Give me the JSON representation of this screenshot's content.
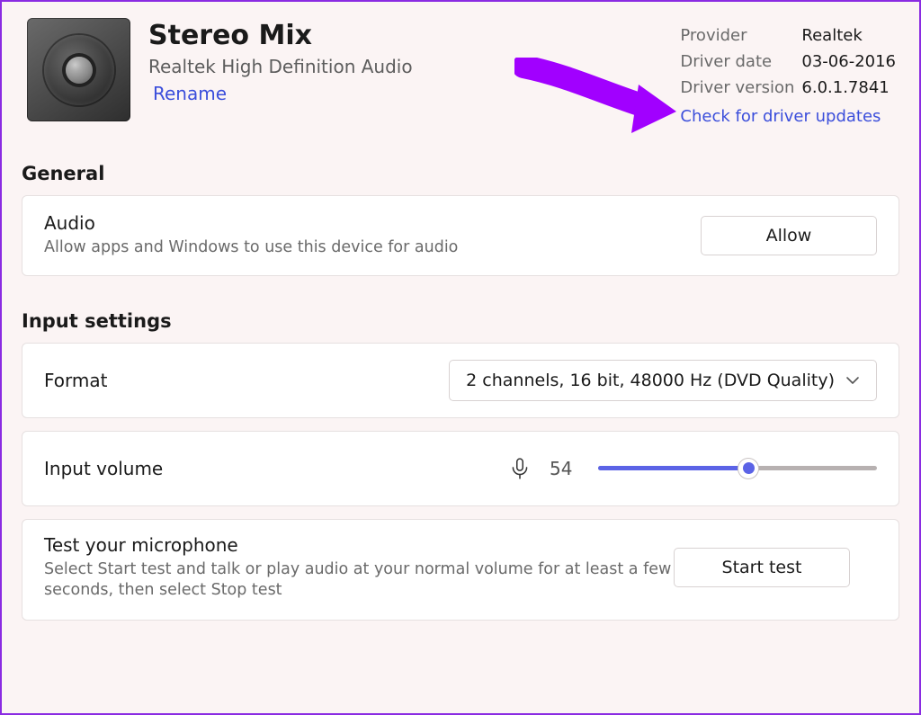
{
  "header": {
    "device_name": "Stereo Mix",
    "device_sub": "Realtek High Definition Audio",
    "rename_label": "Rename",
    "provider_label": "Provider",
    "provider_value": "Realtek",
    "date_label": "Driver date",
    "date_value": "03-06-2016",
    "version_label": "Driver version",
    "version_value": "6.0.1.7841",
    "check_updates_label": "Check for driver updates"
  },
  "sections": {
    "general_title": "General",
    "input_title": "Input settings"
  },
  "audio_card": {
    "title": "Audio",
    "sub": "Allow apps and Windows to use this device for audio",
    "button": "Allow"
  },
  "format_card": {
    "title": "Format",
    "selected": "2 channels, 16 bit, 48000 Hz (DVD Quality)"
  },
  "volume_card": {
    "title": "Input volume",
    "value": "54",
    "percent": 54
  },
  "test_card": {
    "title": "Test your microphone",
    "sub": "Select Start test and talk or play audio at your normal volume for at least a few seconds, then select Stop test",
    "button": "Start test"
  },
  "colors": {
    "accent": "#5B63E6",
    "link": "#3B4EDB",
    "arrow": "#A100FF"
  }
}
